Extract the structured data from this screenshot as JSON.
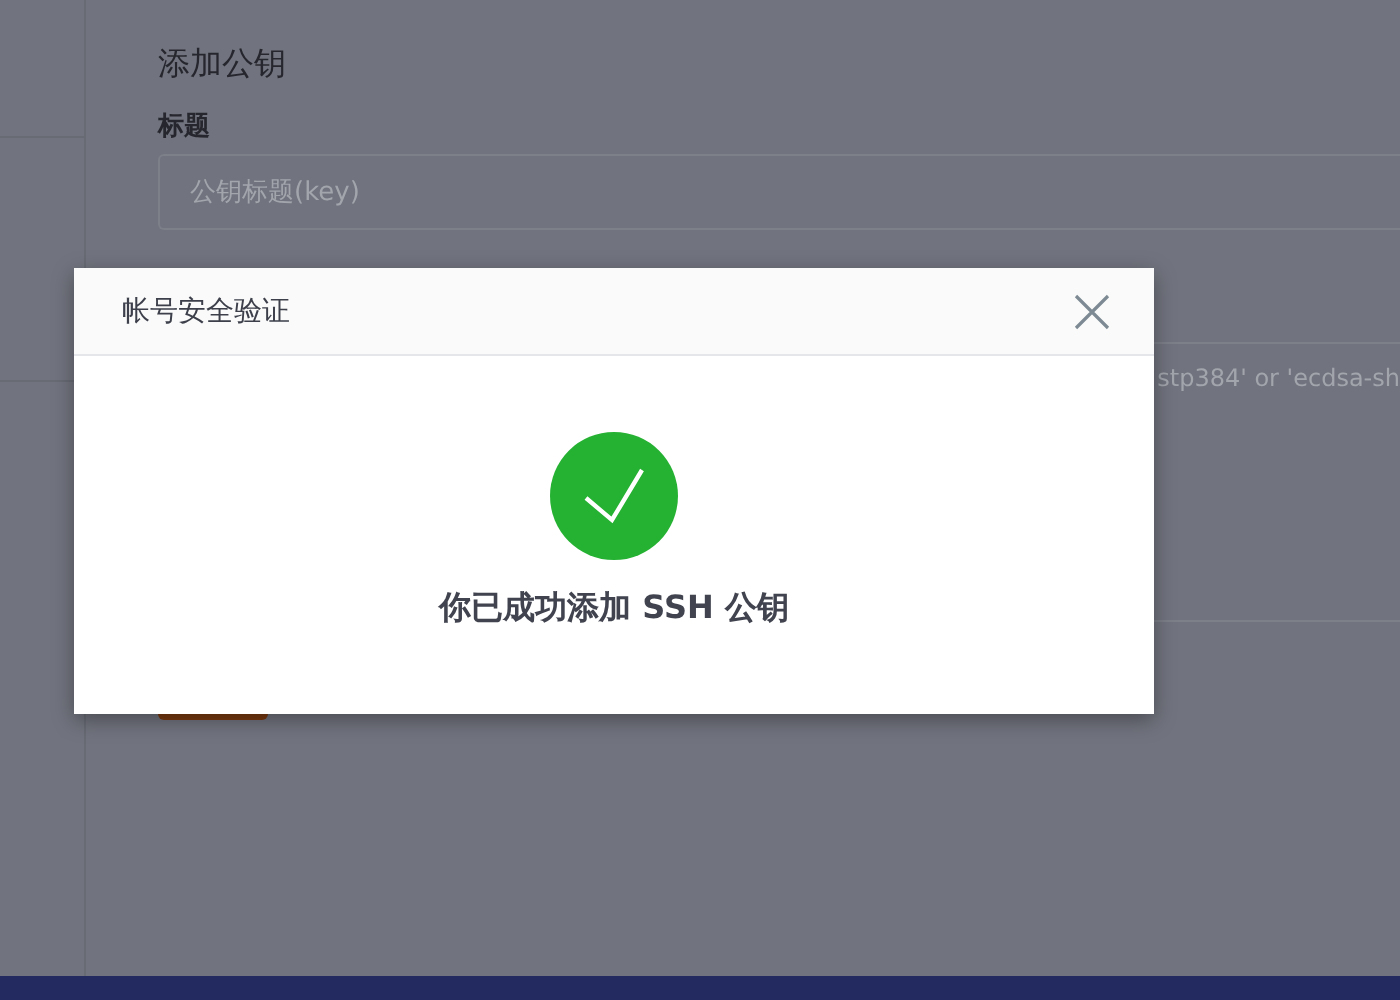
{
  "page": {
    "heading": "添加公钥",
    "title_field": {
      "label": "标题",
      "placeholder": "公钥标题(key)"
    },
    "key_field": {
      "placeholder": "stp384' or 'ecdsa-sh"
    }
  },
  "dialog": {
    "title": "帐号安全验证",
    "message": "你已成功添加 SSH 公钥"
  }
}
